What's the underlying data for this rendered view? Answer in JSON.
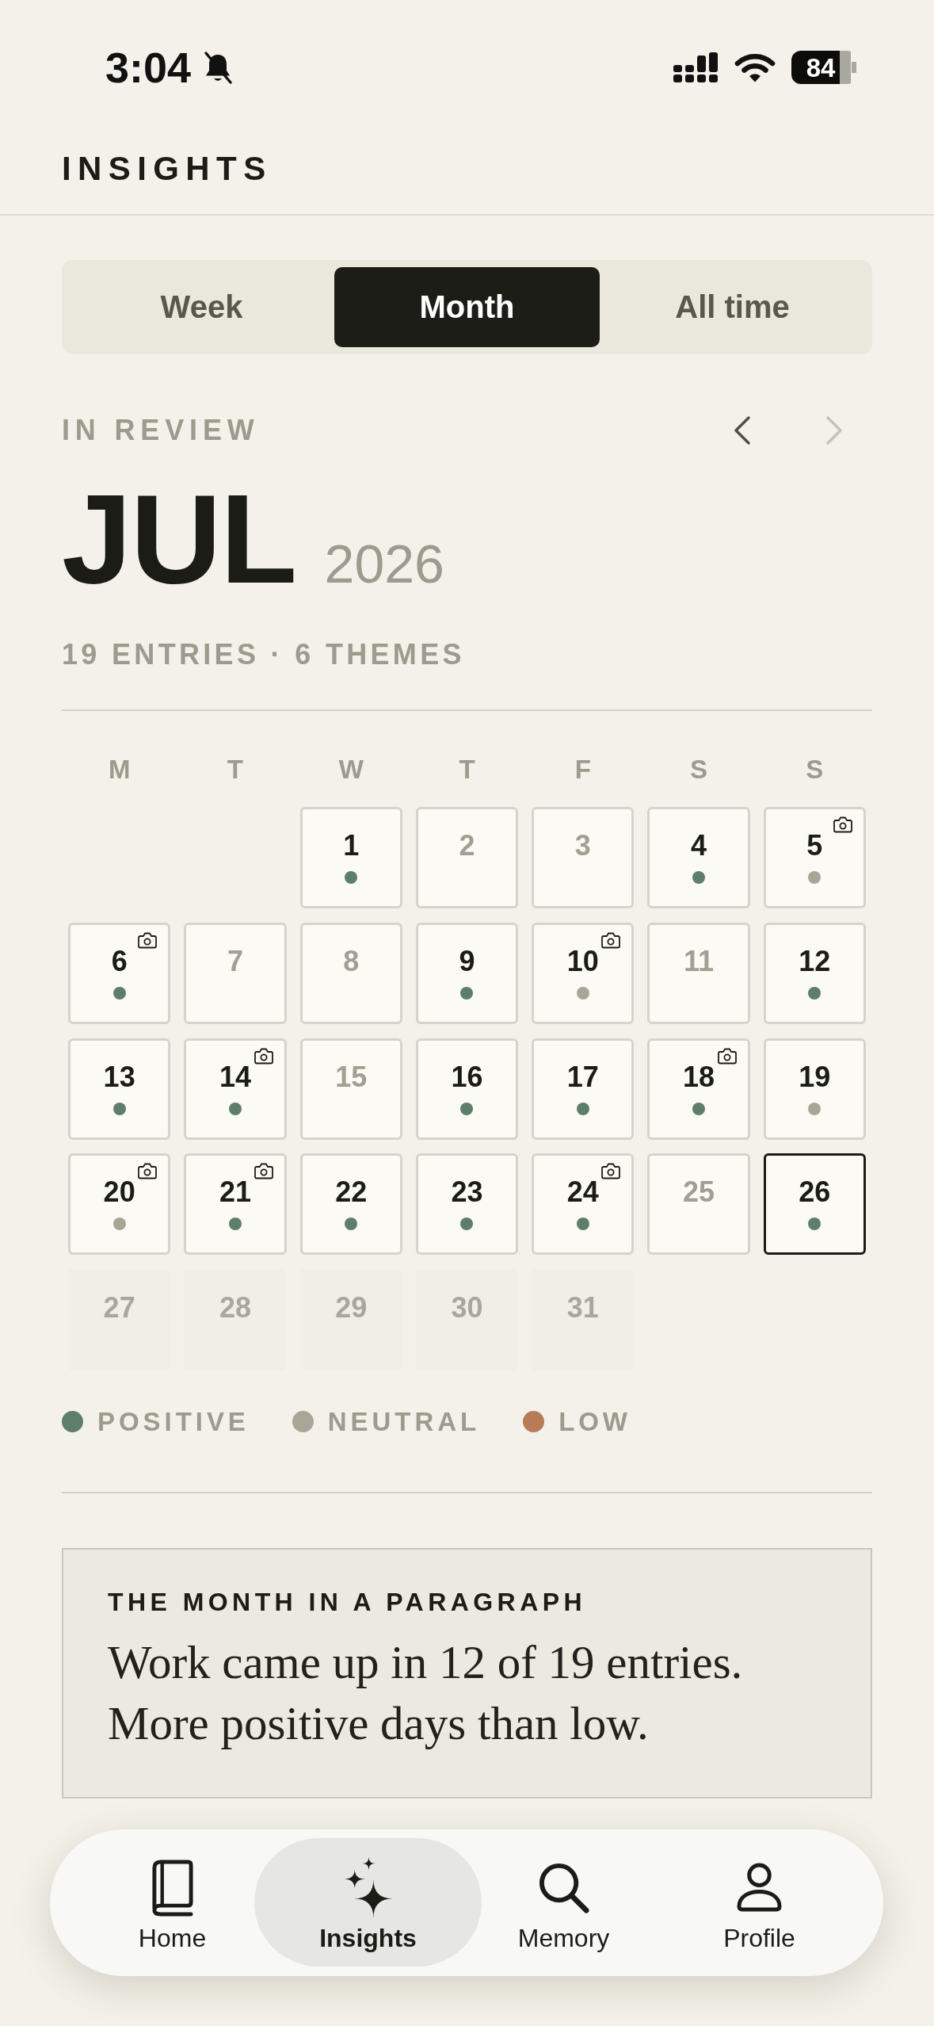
{
  "status_bar": {
    "time": "3:04",
    "muted": true,
    "battery": "84"
  },
  "header": {
    "title": "INSIGHTS"
  },
  "tabs": [
    {
      "label": "Week",
      "selected": false
    },
    {
      "label": "Month",
      "selected": true
    },
    {
      "label": "All time",
      "selected": false
    }
  ],
  "review": {
    "eyebrow": "IN REVIEW",
    "nav": [
      {
        "kind": "previous",
        "disabled": false
      },
      {
        "kind": "next",
        "disabled": true
      }
    ],
    "month": "JUL",
    "year": "2026",
    "stats": "19 ENTRIES · 6 THEMES"
  },
  "calendar": {
    "weekdays": [
      "M",
      "T",
      "W",
      "T",
      "F",
      "S",
      "S"
    ],
    "days": [
      {
        "kind": "pad"
      },
      {
        "kind": "pad"
      },
      {
        "kind": "entry",
        "label": "1",
        "color": "#5f7e69",
        "photo": false,
        "selected": false
      },
      {
        "kind": "empty",
        "label": "2",
        "photo": false,
        "selected": false
      },
      {
        "kind": "empty",
        "label": "3",
        "photo": false,
        "selected": false
      },
      {
        "kind": "entry",
        "label": "4",
        "color": "#5f7e69",
        "photo": false,
        "selected": false
      },
      {
        "kind": "entry",
        "label": "5",
        "color": "#a9a698",
        "photo": true,
        "selected": false
      },
      {
        "kind": "entry",
        "label": "6",
        "color": "#5f7e69",
        "photo": true,
        "selected": false
      },
      {
        "kind": "empty",
        "label": "7",
        "photo": false,
        "selected": false
      },
      {
        "kind": "empty",
        "label": "8",
        "photo": false,
        "selected": false
      },
      {
        "kind": "entry",
        "label": "9",
        "color": "#5f7e69",
        "photo": false,
        "selected": false
      },
      {
        "kind": "entry",
        "label": "10",
        "color": "#a9a698",
        "photo": true,
        "selected": false
      },
      {
        "kind": "empty",
        "label": "11",
        "photo": false,
        "selected": false
      },
      {
        "kind": "entry",
        "label": "12",
        "color": "#5f7e69",
        "photo": false,
        "selected": false
      },
      {
        "kind": "entry",
        "label": "13",
        "color": "#5f7e69",
        "photo": false,
        "selected": false
      },
      {
        "kind": "entry",
        "label": "14",
        "color": "#5f7e69",
        "photo": true,
        "selected": false
      },
      {
        "kind": "empty",
        "label": "15",
        "photo": false,
        "selected": false
      },
      {
        "kind": "entry",
        "label": "16",
        "color": "#5f7e69",
        "photo": false,
        "selected": false
      },
      {
        "kind": "entry",
        "label": "17",
        "color": "#5f7e69",
        "photo": false,
        "selected": false
      },
      {
        "kind": "entry",
        "label": "18",
        "color": "#5f7e69",
        "photo": true,
        "selected": false
      },
      {
        "kind": "entry",
        "label": "19",
        "color": "#a9a698",
        "photo": false,
        "selected": false
      },
      {
        "kind": "entry",
        "label": "20",
        "color": "#a9a698",
        "photo": true,
        "selected": false
      },
      {
        "kind": "entry",
        "label": "21",
        "color": "#5f7e69",
        "photo": true,
        "selected": false
      },
      {
        "kind": "entry",
        "label": "22",
        "color": "#5f7e69",
        "photo": false,
        "selected": false
      },
      {
        "kind": "entry",
        "label": "23",
        "color": "#5f7e69",
        "photo": false,
        "selected": false
      },
      {
        "kind": "entry",
        "label": "24",
        "color": "#5f7e69",
        "photo": true,
        "selected": false
      },
      {
        "kind": "empty",
        "label": "25",
        "photo": false,
        "selected": false
      },
      {
        "kind": "entry",
        "label": "26",
        "color": "#5f7e69",
        "photo": false,
        "selected": true
      },
      {
        "kind": "future",
        "label": "27",
        "photo": false,
        "selected": false
      },
      {
        "kind": "future",
        "label": "28",
        "photo": false,
        "selected": false
      },
      {
        "kind": "future",
        "label": "29",
        "photo": false,
        "selected": false
      },
      {
        "kind": "future",
        "label": "30",
        "photo": false,
        "selected": false
      },
      {
        "kind": "future",
        "label": "31",
        "photo": false,
        "selected": false
      }
    ]
  },
  "legend": [
    {
      "label": "POSITIVE",
      "color": "#5f7e69"
    },
    {
      "label": "NEUTRAL",
      "color": "#a9a698"
    },
    {
      "label": "LOW",
      "color": "#b77b58"
    }
  ],
  "summary_card": {
    "title": "THE MONTH IN A PARAGRAPH",
    "text": "Work came up in 12 of 19 entries.\nMore positive days than low."
  },
  "bottom_nav": [
    {
      "label": "Home",
      "selected": false
    },
    {
      "label": "Insights",
      "selected": true
    },
    {
      "label": "Memory",
      "selected": false
    },
    {
      "label": "Profile",
      "selected": false
    }
  ]
}
